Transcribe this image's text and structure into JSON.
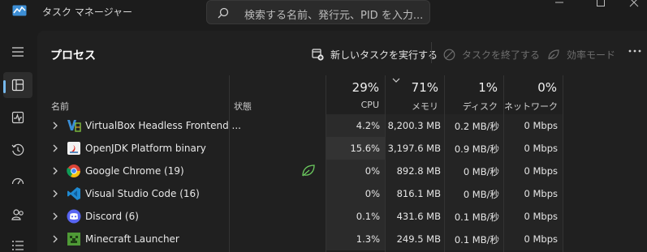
{
  "titlebar": {
    "app_title": "タスク マネージャー",
    "search_placeholder": "検索する名前、発行元、PID を入力..."
  },
  "nav": {
    "items": [
      {
        "icon": "hamburger-menu-icon"
      },
      {
        "icon": "processes-icon",
        "active": true
      },
      {
        "icon": "performance-icon"
      },
      {
        "icon": "app-history-icon"
      },
      {
        "icon": "startup-apps-icon"
      },
      {
        "icon": "users-icon"
      },
      {
        "icon": "details-icon"
      }
    ]
  },
  "header": {
    "page_title": "プロセス",
    "run_new_task": "新しいタスクを実行する",
    "end_task": "タスクを終了する",
    "efficiency_mode": "効率モード"
  },
  "columns": {
    "name": "名前",
    "status": "状態",
    "cpu": {
      "percent": "29%",
      "label": "CPU"
    },
    "memory": {
      "percent": "71%",
      "label": "メモリ"
    },
    "disk": {
      "percent": "1%",
      "label": "ディスク"
    },
    "network": {
      "percent": "0%",
      "label": "ネットワーク"
    }
  },
  "processes": [
    {
      "name": "VirtualBox Headless Frontend ...",
      "icon": "virtualbox-icon",
      "efficiency": false,
      "cpu": "4.2%",
      "memory": "8,200.3 MB",
      "disk": "0.2 MB/秒",
      "network": "0 Mbps"
    },
    {
      "name": "OpenJDK Platform binary",
      "icon": "java-icon",
      "efficiency": false,
      "cpu": "15.6%",
      "memory": "3,197.6 MB",
      "disk": "0.9 MB/秒",
      "network": "0 Mbps"
    },
    {
      "name": "Google Chrome (19)",
      "icon": "chrome-icon",
      "efficiency": true,
      "cpu": "0%",
      "memory": "892.8 MB",
      "disk": "0 MB/秒",
      "network": "0 Mbps"
    },
    {
      "name": "Visual Studio Code (16)",
      "icon": "vscode-icon",
      "efficiency": false,
      "cpu": "0%",
      "memory": "816.1 MB",
      "disk": "0 MB/秒",
      "network": "0 Mbps"
    },
    {
      "name": "Discord (6)",
      "icon": "discord-icon",
      "efficiency": false,
      "cpu": "0.1%",
      "memory": "431.6 MB",
      "disk": "0.1 MB/秒",
      "network": "0 Mbps"
    },
    {
      "name": "Minecraft Launcher",
      "icon": "minecraft-icon",
      "efficiency": false,
      "cpu": "1.3%",
      "memory": "249.5 MB",
      "disk": "0.1 MB/秒",
      "network": "0 Mbps"
    }
  ],
  "colors": {
    "accent": "#76b9ed",
    "background": "#1c1c1c",
    "panel": "#202020",
    "cpu_heat": "#2b2b2b"
  }
}
